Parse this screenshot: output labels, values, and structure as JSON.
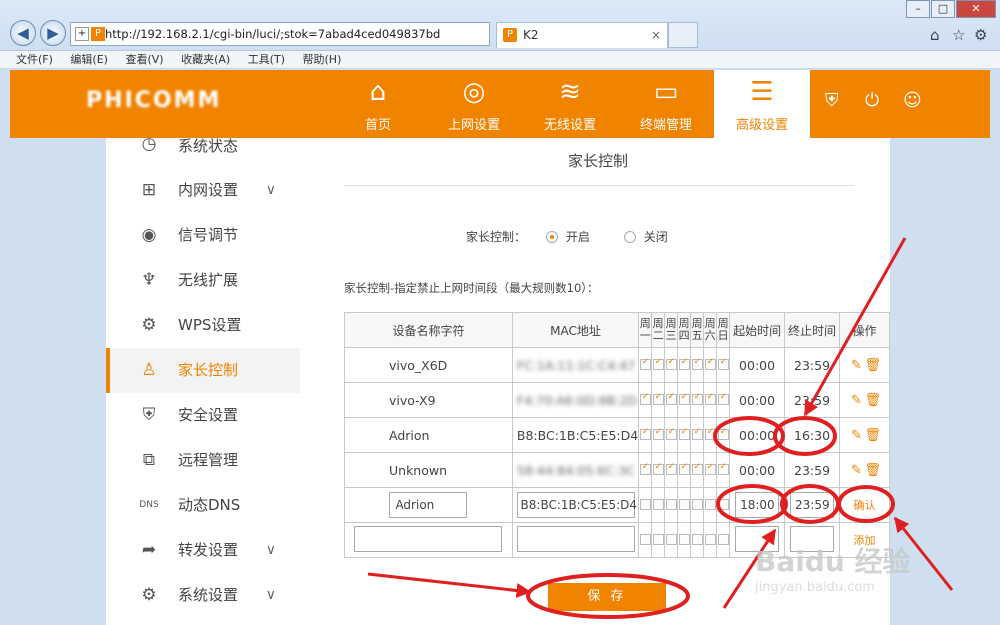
{
  "browser": {
    "address": "http://192.168.2.1/cgi-bin/luci/;stok=7abad4ced049837bd",
    "tab_title": "K2",
    "menu": [
      "文件(F)",
      "编辑(E)",
      "查看(V)",
      "收藏夹(A)",
      "工具(T)",
      "帮助(H)"
    ]
  },
  "router": {
    "logo": "PHICOMM",
    "nav": [
      {
        "label": "首页",
        "icon": "home-icon"
      },
      {
        "label": "上网设置",
        "icon": "globe-icon"
      },
      {
        "label": "无线设置",
        "icon": "wifi-icon"
      },
      {
        "label": "终端管理",
        "icon": "devices-icon"
      },
      {
        "label": "高级设置",
        "icon": "sliders-icon"
      }
    ]
  },
  "sidebar": {
    "items": [
      {
        "label": "系统状态",
        "icon": "clock-icon"
      },
      {
        "label": "内网设置",
        "icon": "network-icon",
        "expand": true
      },
      {
        "label": "信号调节",
        "icon": "signal-icon"
      },
      {
        "label": "无线扩展",
        "icon": "antenna-icon"
      },
      {
        "label": "WPS设置",
        "icon": "wps-icon"
      },
      {
        "label": "家长控制",
        "icon": "parent-icon",
        "active": true
      },
      {
        "label": "安全设置",
        "icon": "shield-icon"
      },
      {
        "label": "远程管理",
        "icon": "remote-icon"
      },
      {
        "label": "动态DNS",
        "icon": "dns-icon"
      },
      {
        "label": "转发设置",
        "icon": "forward-icon",
        "expand": true
      },
      {
        "label": "系统设置",
        "icon": "gear-icon",
        "expand": true
      }
    ]
  },
  "main": {
    "title": "家长控制",
    "toggle_label": "家长控制：",
    "opt_on": "开启",
    "opt_off": "关闭",
    "desc": "家长控制-指定禁止上网时间段（最大规则数10）：",
    "table": {
      "headers": {
        "name": "设备名称字符",
        "mac": "MAC地址",
        "days": [
          "周一",
          "周二",
          "周三",
          "周四",
          "周五",
          "周六",
          "周日"
        ],
        "start": "起始时间",
        "end": "终止时间",
        "op": "操作"
      },
      "rows": [
        {
          "name": "vivo_X6D",
          "mac": "FC:1A:11:1C:C4:47",
          "start": "00:00",
          "end": "23:59"
        },
        {
          "name": "vivo-X9",
          "mac": "F4:70:A6:0D:8B:2D",
          "start": "00:00",
          "end": "23:59"
        },
        {
          "name": "Adrion",
          "mac": "B8:BC:1B:C5:E5:D4",
          "start": "00:00",
          "end": "16:30"
        },
        {
          "name": "Unknown",
          "mac": "58:44:84:05:6C:3C",
          "start": "00:00",
          "end": "23:59"
        }
      ],
      "edit_row": {
        "name": "Adrion",
        "mac": "B8:BC:1B:C5:E5:D4",
        "start": "18:00",
        "end": "23:59",
        "confirm": "确认"
      },
      "add_label": "添加"
    },
    "save": "保 存"
  },
  "watermark": {
    "brand": "Baidu 经验",
    "url": "jingyan.baidu.com"
  },
  "colors": {
    "accent": "#f08300",
    "annotation": "#e02020"
  }
}
